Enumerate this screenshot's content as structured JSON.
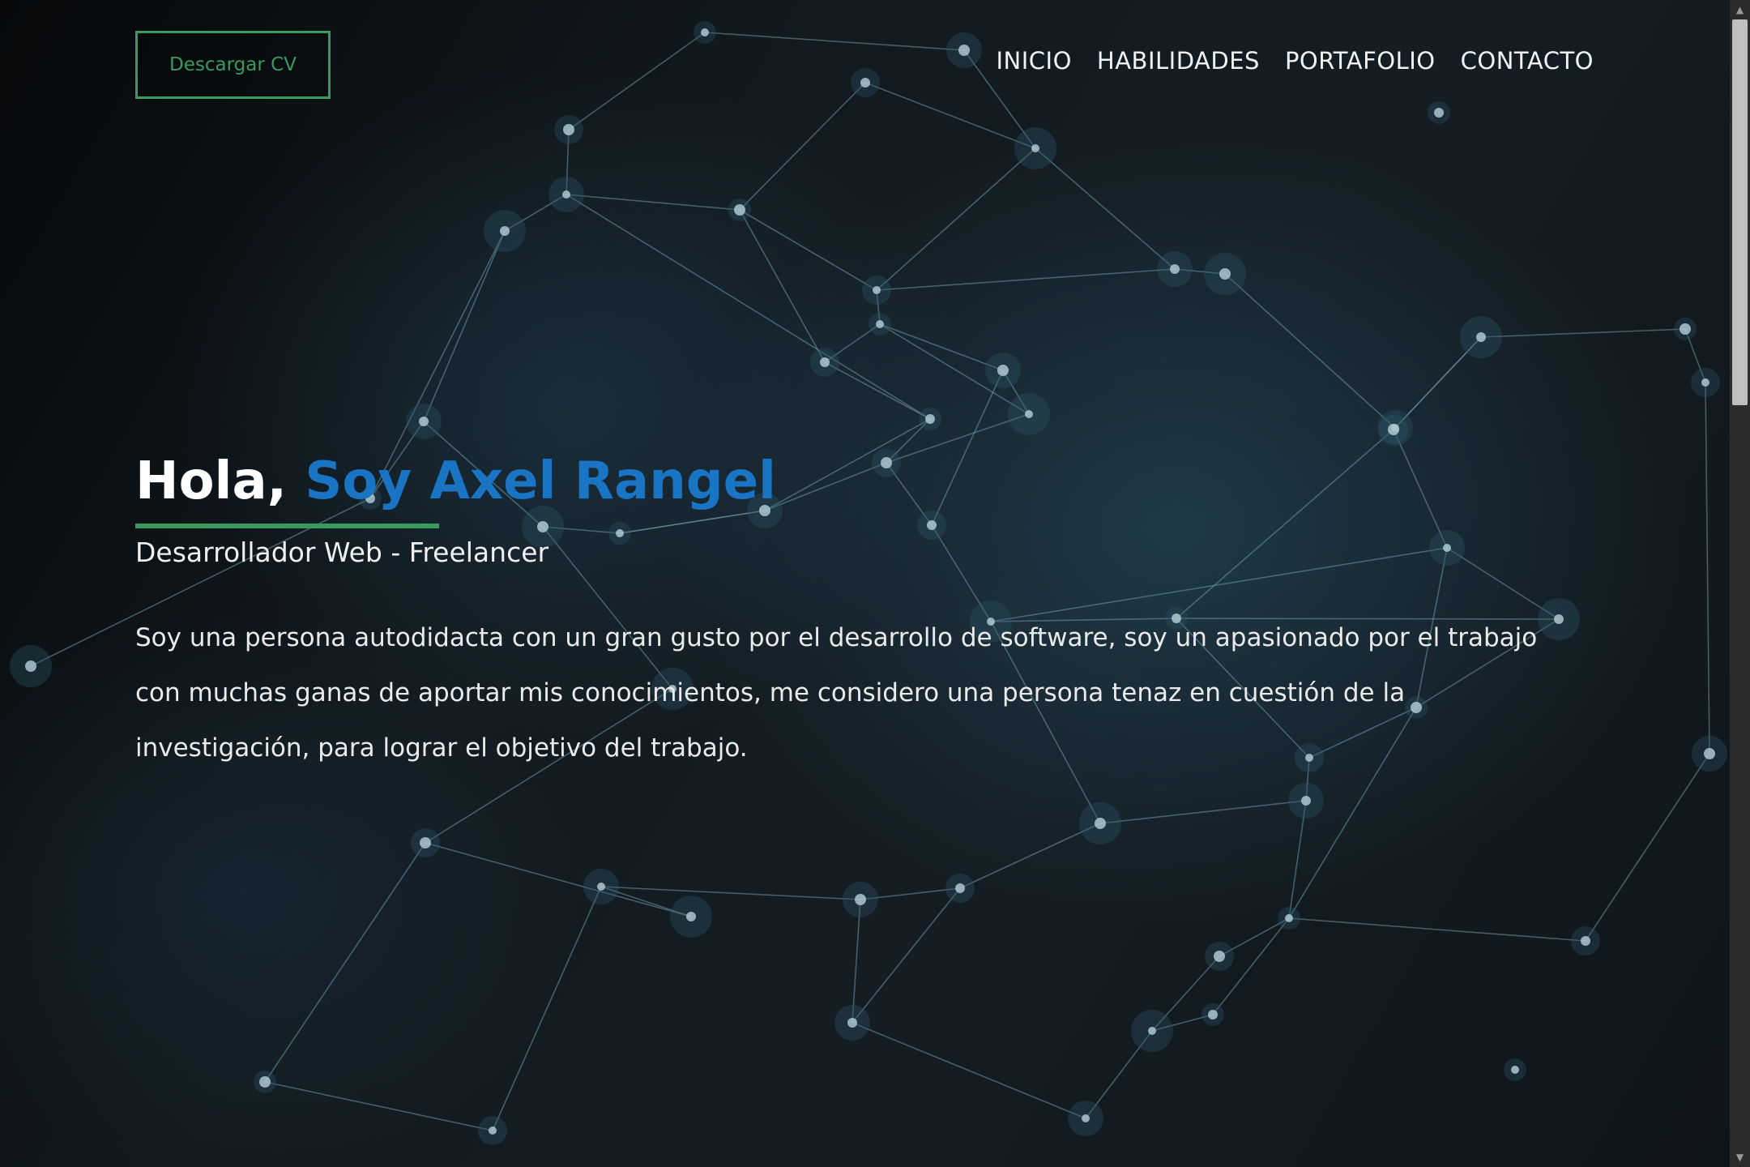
{
  "header": {
    "cv_button_label": "Descargar CV",
    "nav": [
      {
        "label": "INICIO"
      },
      {
        "label": "HABILIDADES"
      },
      {
        "label": "PORTAFOLIO"
      },
      {
        "label": "CONTACTO"
      }
    ]
  },
  "hero": {
    "greeting": "Hola,",
    "name": "Soy Axel Rangel",
    "subtitle": "Desarrollador Web - Freelancer",
    "bio": "Soy una persona autodidacta con un gran gusto por el desarrollo de software, soy un apasionado por el trabajo con muchas ganas de aportar mis conocimientos, me considero una persona tenaz en cuestión de la investigación, para lograr el objetivo del trabajo."
  },
  "colors": {
    "accent_green": "#3a9a5c",
    "accent_blue": "#1a74c4",
    "background": "#0d1418",
    "network_nodes": "#b8cfd8",
    "network_lines": "#6f96a6"
  },
  "icons": {
    "scroll_up": "chevron-up-icon",
    "scroll_down": "chevron-down-icon"
  }
}
